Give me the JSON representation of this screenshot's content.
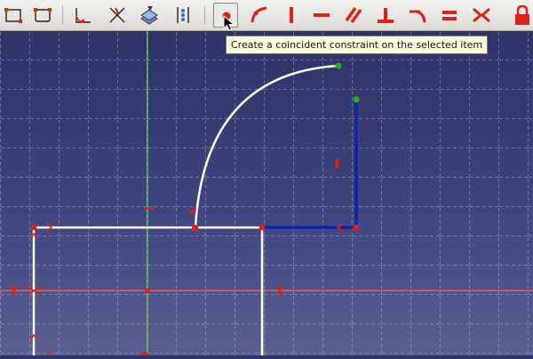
{
  "tooltip": {
    "text": "Create a coincident constraint on the selected item"
  },
  "toolbar": {
    "active_tool": "coincident-constraint",
    "accent_color": "#d8241a",
    "tools": [
      "rectangle-icon",
      "rounded-rectangle-icon",
      "fillet-icon",
      "trim-icon",
      "external-geometry-icon",
      "carbon-copy-icon",
      "coincident-constraint-icon",
      "point-on-object-constraint-icon",
      "vertical-constraint-icon",
      "horizontal-constraint-icon",
      "parallel-constraint-icon",
      "perpendicular-constraint-icon",
      "tangent-constraint-icon",
      "equal-constraint-icon",
      "symmetric-constraint-icon",
      "lock-constraint-icon"
    ]
  },
  "colors": {
    "background_top": "#2e3365",
    "background_bottom": "#5a5f8e",
    "grid": "#c8cbe0",
    "geometry": "#ffffff",
    "selected": "#0a1fb0",
    "constraint": "#e02010",
    "v_axis": "#5ec25e",
    "h_axis": "#e06060",
    "endpoint_green": "#22b022"
  }
}
